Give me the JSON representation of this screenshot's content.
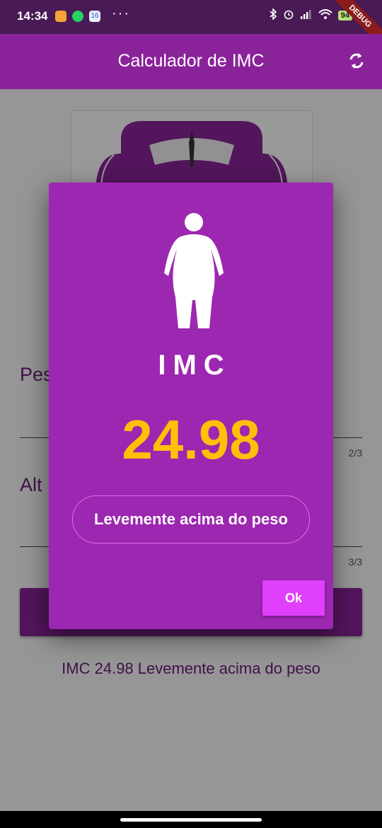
{
  "status_bar": {
    "time": "14:34",
    "notification_badge": "16",
    "more": "···",
    "battery": "94"
  },
  "debug_banner": "DEBUG",
  "app_bar": {
    "title": "Calculador de IMC",
    "refresh_icon": "refresh-icon"
  },
  "form": {
    "weight_label": "Pes",
    "weight_counter": "2/3",
    "height_label": "Alt",
    "height_counter": "3/3"
  },
  "result_text": "IMC 24.98 Levemente acima do peso",
  "dialog": {
    "icon": "person-obese-icon",
    "label": "IMC",
    "value": "24.98",
    "classification": "Levemente acima do peso",
    "ok_label": "Ok"
  },
  "colors": {
    "primary": "#8a239a",
    "dialog_bg": "#9c27b0",
    "value_accent": "#ffc107",
    "ok_button": "#e040fb"
  }
}
